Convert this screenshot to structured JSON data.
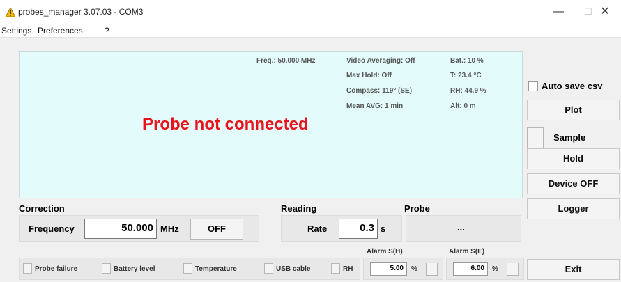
{
  "window": {
    "title": "probes_manager 3.07.03 - COM3",
    "minimize_glyph": "—",
    "maximize_glyph": "☐",
    "close_glyph": "✕"
  },
  "menu": [
    "Settings",
    "Preferences",
    "?"
  ],
  "display": {
    "freq": "Freq.: 50.000 MHz",
    "video_averaging": "Video Averaging: Off",
    "max_hold": "Max Hold: Off",
    "compass": "Compass: 119° (SE)",
    "mean_avg": "Mean AVG: 1 min",
    "battery": "Bat.:  10 %",
    "temperature": "T: 23.4 °C",
    "humidity": "RH: 44.9 %",
    "altitude": "Alt: 0 m",
    "message": "Probe not connected",
    "message_color": "#e8131b"
  },
  "right": {
    "auto_save_label": "Auto save csv",
    "plot": "Plot",
    "sample": "Sample",
    "hold": "Hold",
    "device_off": "Device OFF",
    "logger": "Logger",
    "exit": "Exit"
  },
  "correction": {
    "section_label": "Correction",
    "frequency_label": "Frequency",
    "frequency_value": "50.000",
    "unit": "MHz",
    "off_button": "OFF"
  },
  "reading": {
    "section_label": "Reading",
    "rate_label": "Rate",
    "rate_value": "0.3",
    "unit": "s"
  },
  "probe": {
    "section_label": "Probe",
    "value": "..."
  },
  "alarm_h": {
    "label": "Alarm S(H)",
    "value": "5.00",
    "unit": "%"
  },
  "alarm_e": {
    "label": "Alarm S(E)",
    "value": "6.00",
    "unit": "%"
  },
  "status": [
    "Probe failure",
    "Battery level",
    "Temperature",
    "USB cable",
    "RH"
  ]
}
